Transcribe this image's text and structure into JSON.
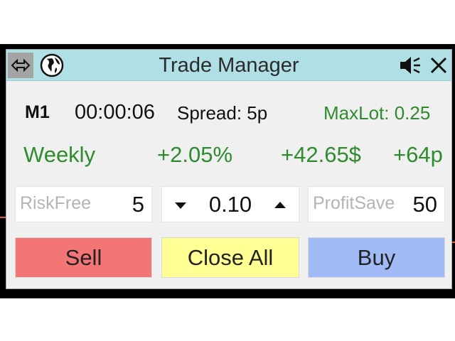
{
  "window": {
    "title": "Trade Manager",
    "title_bg": "#b0dfe6",
    "icons": [
      "move-arrows-icon",
      "globe-icon",
      "speaker-icon",
      "close-icon"
    ]
  },
  "status": {
    "timeframe": "M1",
    "timer": "00:00:06",
    "spread": "Spread: 5p",
    "maxlot": "MaxLot: 0.25"
  },
  "performance": {
    "period": "Weekly",
    "percent": "+2.05%",
    "money": "+42.65$",
    "pips": "+64p",
    "color": "#2e8b2e"
  },
  "inputs": {
    "riskfree": {
      "label": "RiskFree",
      "value": "5"
    },
    "lot": {
      "value": "0.10"
    },
    "profitsave": {
      "label": "ProfitSave",
      "value": "50"
    }
  },
  "actions": {
    "sell": {
      "label": "Sell",
      "color": "#f47575"
    },
    "close_all": {
      "label": "Close All",
      "color": "#ffff94"
    },
    "buy": {
      "label": "Buy",
      "color": "#a0baf6"
    }
  }
}
